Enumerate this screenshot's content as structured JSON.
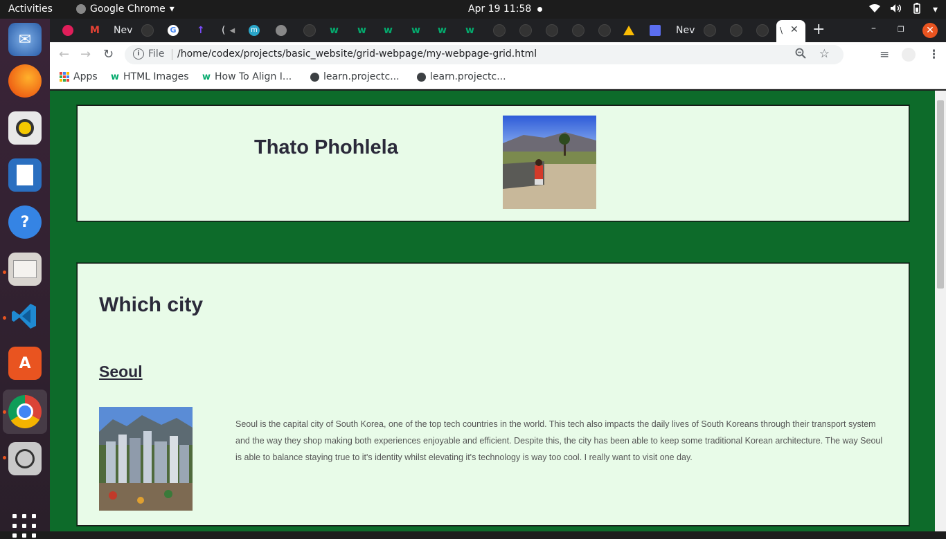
{
  "topbar": {
    "activities": "Activities",
    "app_name": "Google Chrome",
    "clock": "Apr 19  11:58"
  },
  "dock": {
    "items": [
      "thunderbird-icon",
      "firefox-icon",
      "rhythmbox-icon",
      "libreoffice-writer-icon",
      "help-icon",
      "files-icon",
      "vscode-icon",
      "software-center-icon",
      "chrome-icon",
      "screenshot-icon"
    ]
  },
  "tabs": {
    "labels": [
      "Nev",
      "(",
      "Nev",
      "\\"
    ]
  },
  "toolbar": {
    "scheme": "File",
    "url": "/home/codex/projects/basic_website/grid-webpage/my-webpage-grid.html"
  },
  "bookmarks": [
    "Apps",
    "HTML Images",
    "How To Align I...",
    "learn.projectc...",
    "learn.projectc..."
  ],
  "page": {
    "name": "Thato Phohlela",
    "section_heading": "Which city",
    "city_name": "Seoul",
    "city_description": "Seoul is the capital city of South Korea, one of the top tech countries in the world. This tech also impacts the daily lives of South Koreans through their transport system and the way they shop making both experiences enjoyable and efficient. Despite this, the city has been able to keep some traditional Korean architecture. The way Seoul is able to balance staying true to it's identity whilst elevating it's technology is way too cool. I really want to visit one day."
  },
  "colors": {
    "page_background": "#0d6b2a",
    "card_background": "#e8fbe8",
    "heading_text": "#2b2a3a"
  }
}
